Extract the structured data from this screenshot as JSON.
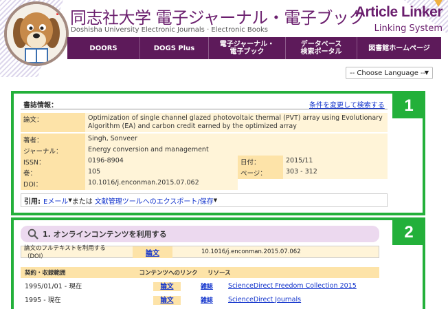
{
  "header": {
    "title": "同志社大学 電子ジャーナル・電子ブック",
    "subtitle": "Doshisha University Electronic Journals · Electronic Books",
    "brand_title": "Article Linker",
    "brand_subtitle": "Linking System",
    "brand_color": "#6b1f6e"
  },
  "nav": [
    {
      "label": "DOORS",
      "width": 106
    },
    {
      "label": "DOGS Plus",
      "width": 100
    },
    {
      "label": "電子ジャーナル・\n電子ブック",
      "width": 112
    },
    {
      "label": "データベース\n検索ポータル",
      "width": 104
    },
    {
      "label": "図書館ホームページ",
      "width": 122
    }
  ],
  "language": {
    "selected": "-- Choose Language --"
  },
  "biblio": {
    "heading": "書誌情報：",
    "change_link": "条件を変更して検索する",
    "article_label": "論文：",
    "article": "Optimization of single channel glazed photovoltaic thermal (PVT) array using Evolutionary Algorithm (EA) and carbon credit earned by the optimized array",
    "author_label": "著者：",
    "author": "Singh, Sonveer",
    "journal_label": "ジャーナル：",
    "journal": "Energy conversion and management",
    "issn_label": "ISSN：",
    "issn": "0196-8904",
    "date_label": "日付：",
    "date": "2015/11",
    "volume_label": "巻：",
    "volume": "105",
    "page_label": "ページ：",
    "pages": "303 - 312",
    "doi_label": "DOI：",
    "doi": "10.1016/j.enconman.2015.07.062"
  },
  "citation": {
    "label": "引用:",
    "email": "Eメール",
    "or": "または",
    "export": "文献管理ツールへのエクスポート/保存"
  },
  "badges": {
    "one": "1",
    "two": "2"
  },
  "online": {
    "heading": "1. オンラインコンテンツを利用する",
    "fulltext_label": "論文のフルテキストを利用する（DOI）",
    "fulltext_link": "論文",
    "fulltext_doi": "10.1016/j.enconman.2015.07.062",
    "headers": {
      "range": "契約・収録範囲",
      "link": "コンテンツへのリンク",
      "resource": "リソース"
    },
    "rows": [
      {
        "range": "1995/01/01 - 現在",
        "article": "論文",
        "journal": "雑誌",
        "resource": "ScienceDirect Freedom Collection 2015"
      },
      {
        "range": "1995 - 現在",
        "article": "論文",
        "journal": "雑誌",
        "resource": "ScienceDirect Journals"
      }
    ]
  }
}
